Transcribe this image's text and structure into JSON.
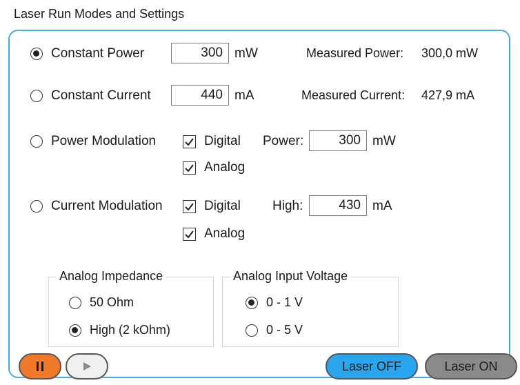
{
  "window": {
    "title": "Laser Run Modes and Settings"
  },
  "modes": {
    "constant_power": {
      "label": "Constant Power",
      "selected": true,
      "value": "300",
      "unit": "mW",
      "measured_label": "Measured Power:",
      "measured_value": "300,0 mW"
    },
    "constant_current": {
      "label": "Constant Current",
      "selected": false,
      "value": "440",
      "unit": "mA",
      "measured_label": "Measured Current:",
      "measured_value": "427,9 mA"
    },
    "power_modulation": {
      "label": "Power Modulation",
      "selected": false,
      "digital_label": "Digital",
      "digital_checked": true,
      "analog_label": "Analog",
      "analog_checked": true,
      "field_label": "Power:",
      "value": "300",
      "unit": "mW"
    },
    "current_modulation": {
      "label": "Current Modulation",
      "selected": false,
      "digital_label": "Digital",
      "digital_checked": true,
      "analog_label": "Analog",
      "analog_checked": true,
      "field_label": "High:",
      "value": "430",
      "unit": "mA"
    }
  },
  "analog_impedance": {
    "title": "Analog Impedance",
    "options": [
      {
        "label": "50 Ohm",
        "selected": false
      },
      {
        "label": "High (2 kOhm)",
        "selected": true
      }
    ]
  },
  "analog_input_voltage": {
    "title": "Analog Input Voltage",
    "options": [
      {
        "label": "0 - 1 V",
        "selected": true
      },
      {
        "label": "0 - 5 V",
        "selected": false
      }
    ]
  },
  "buttons": {
    "pause_icon": "pause-icon",
    "play_icon": "play-icon",
    "laser_off": "Laser OFF",
    "laser_on": "Laser ON"
  },
  "colors": {
    "panel_border": "#49a9e6",
    "pause_button": "#f07a2a",
    "laser_off_button": "#2aa6ee",
    "laser_on_button": "#8a8a8a"
  }
}
